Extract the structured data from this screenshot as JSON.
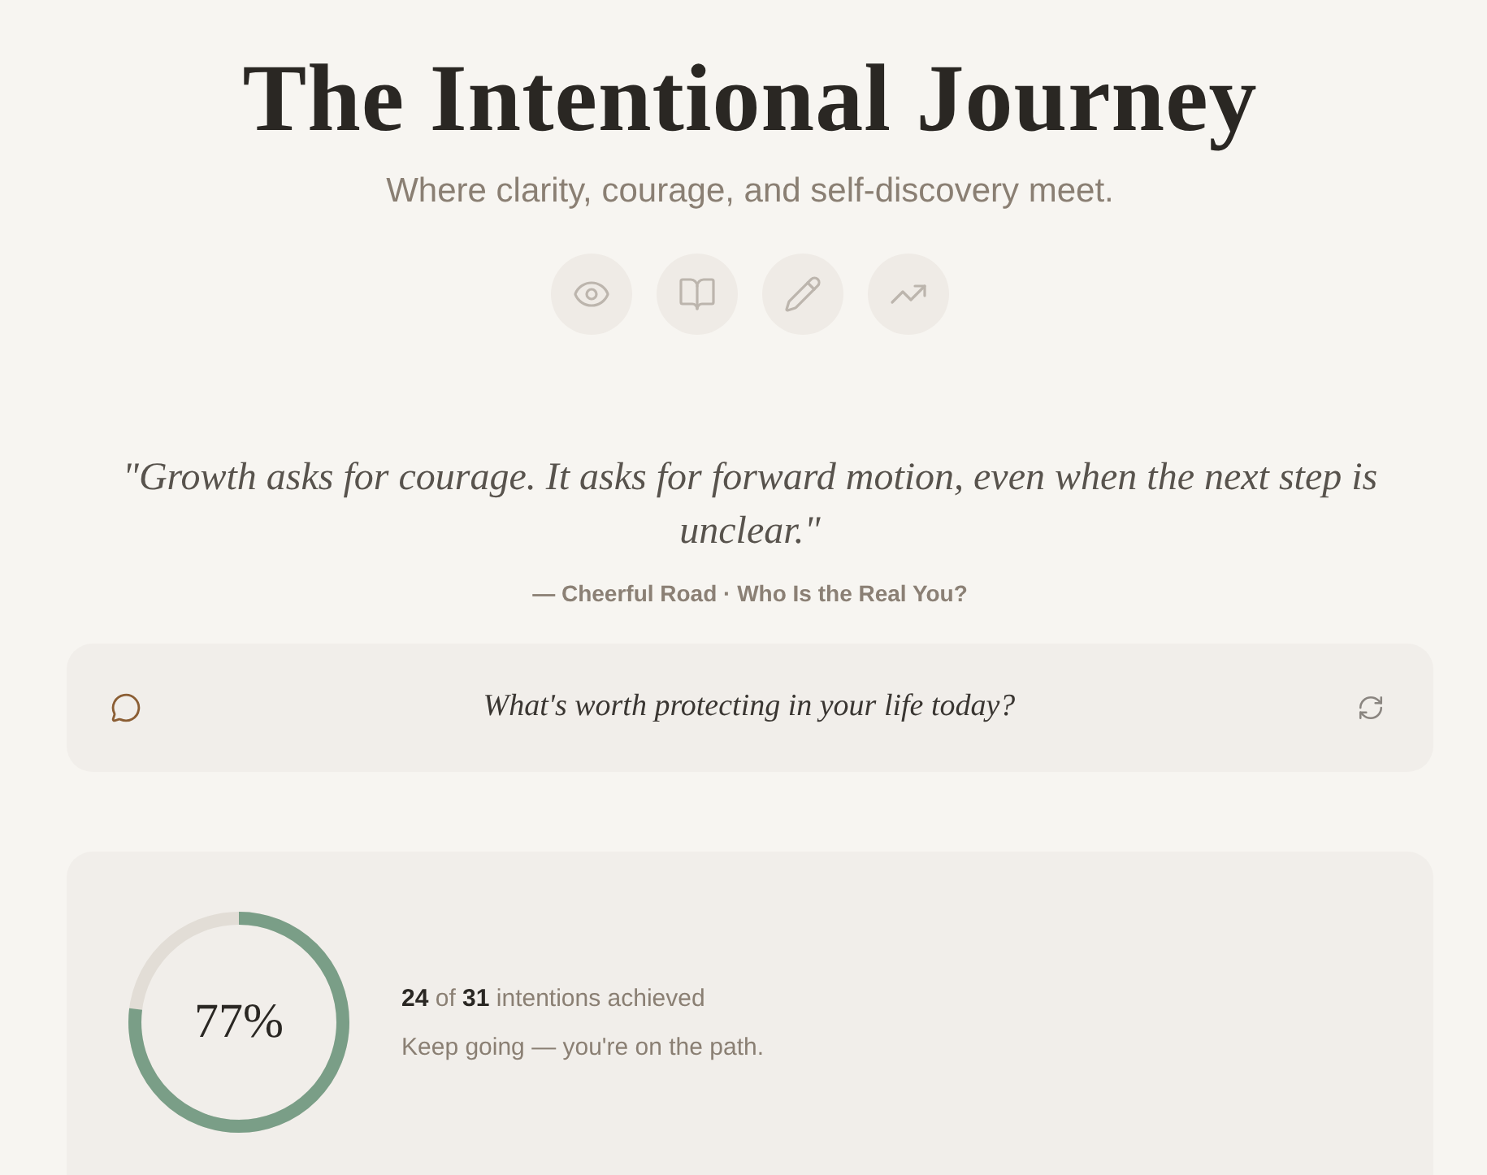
{
  "header": {
    "title": "The Intentional Journey",
    "subtitle": "Where clarity, courage, and self-discovery meet."
  },
  "quote": {
    "text": "\"Growth asks for courage. It asks for forward motion, even when the next step is unclear.\"",
    "attribution": "— Cheerful Road · Who Is the Real You?"
  },
  "prompt": {
    "text": "What's worth protecting in your life today?"
  },
  "progress": {
    "level": 0.77,
    "percent": "77%",
    "summary": "**24** of **31** intentions achieved",
    "message": "Keep going — you're on the path."
  }
}
